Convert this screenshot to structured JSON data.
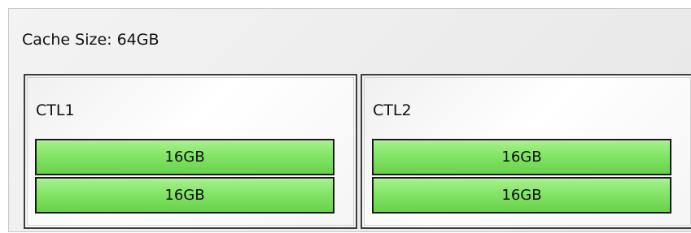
{
  "cache": {
    "title": "Cache Size: 64GB"
  },
  "controllers": [
    {
      "label": "CTL1",
      "modules": [
        {
          "label": "16GB"
        },
        {
          "label": "16GB"
        }
      ]
    },
    {
      "label": "CTL2",
      "modules": [
        {
          "label": "16GB"
        },
        {
          "label": "16GB"
        }
      ]
    }
  ],
  "colors": {
    "panel_background": "#ececec",
    "card_border": "#3f3f3f",
    "module_fill": "#88e66b",
    "module_border": "#1a1a1a"
  }
}
